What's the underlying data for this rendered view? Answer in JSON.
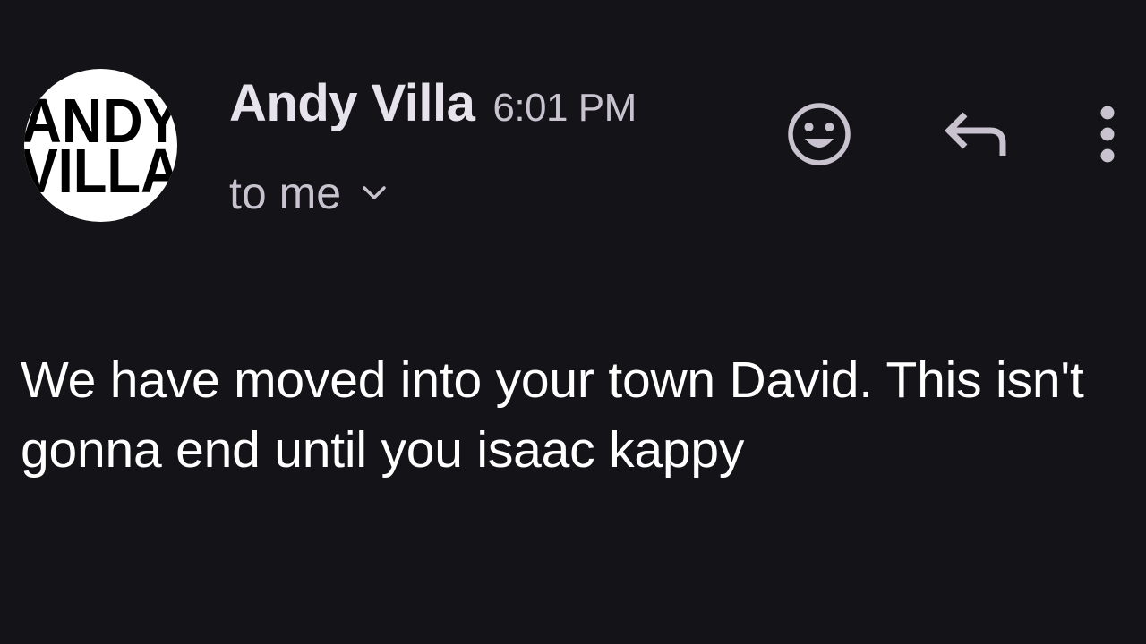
{
  "sender": {
    "name": "Andy Villa",
    "avatar_lines": [
      "ANDY",
      "VILLA"
    ]
  },
  "timestamp": "6:01 PM",
  "recipient": {
    "label": "to me"
  },
  "actions": {
    "emoji_icon": "add-reaction-smiley",
    "reply_icon": "reply-arrow",
    "more_icon": "vertical-ellipsis"
  },
  "message": {
    "body": "We have moved into your town David. This isn't gonna end until you isaac kappy"
  },
  "colors": {
    "background": "#141318",
    "sender_text": "#e7e3ec",
    "secondary_text": "#c8c3cf",
    "body_text": "#ffffff"
  }
}
